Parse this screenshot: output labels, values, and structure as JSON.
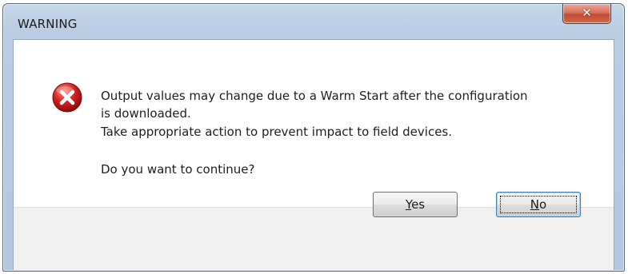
{
  "window": {
    "title": "WARNING",
    "close_symbol": "✕"
  },
  "dialog": {
    "icon": "error-icon",
    "message_lines": [
      "Output values may change due to a Warm Start after the configuration",
      "is downloaded.",
      "Take appropriate action to prevent impact to field devices.",
      "",
      "Do you want to continue?"
    ]
  },
  "buttons": {
    "yes": {
      "accel": "Y",
      "rest": "es"
    },
    "no": {
      "accel": "N",
      "rest": "o"
    }
  },
  "colors": {
    "title_bar": "#b8cce4",
    "close_button": "#c24a32",
    "error_icon": "#d21f1f",
    "button_bar": "#f0f0f0"
  }
}
